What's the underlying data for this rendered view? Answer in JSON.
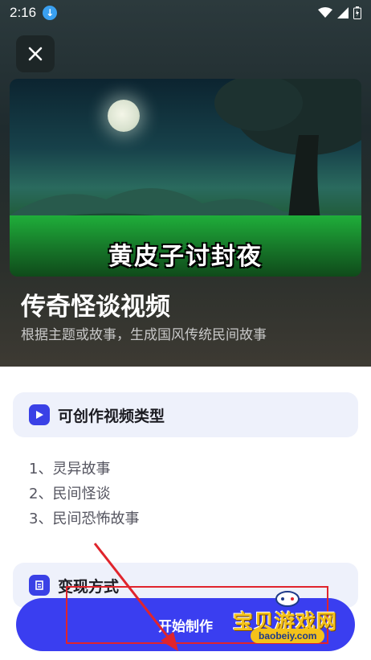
{
  "status_bar": {
    "time": "2:16",
    "icons": [
      "download-icon",
      "wifi-icon",
      "signal-icon",
      "battery-icon"
    ]
  },
  "hero": {
    "close_icon": "close-icon",
    "thumbnail_caption": "黄皮子讨封夜",
    "title": "传奇怪谈视频",
    "subtitle": "根据主题或故事，生成国风传统民间故事"
  },
  "types_card": {
    "icon": "video-play-icon",
    "title": "可创作视频类型",
    "items": [
      "1、灵异故事",
      "2、民间怪谈",
      "3、民间恐怖故事"
    ]
  },
  "monetization_card": {
    "icon": "document-icon",
    "title": "变现方式"
  },
  "cta": {
    "label": "开始制作"
  },
  "watermark": {
    "name": "宝贝游戏网",
    "url": "baobeiy.com"
  },
  "colors": {
    "primary": "#3a3ef0",
    "annotation": "#e0242c",
    "card_bg": "#eef1fb"
  }
}
